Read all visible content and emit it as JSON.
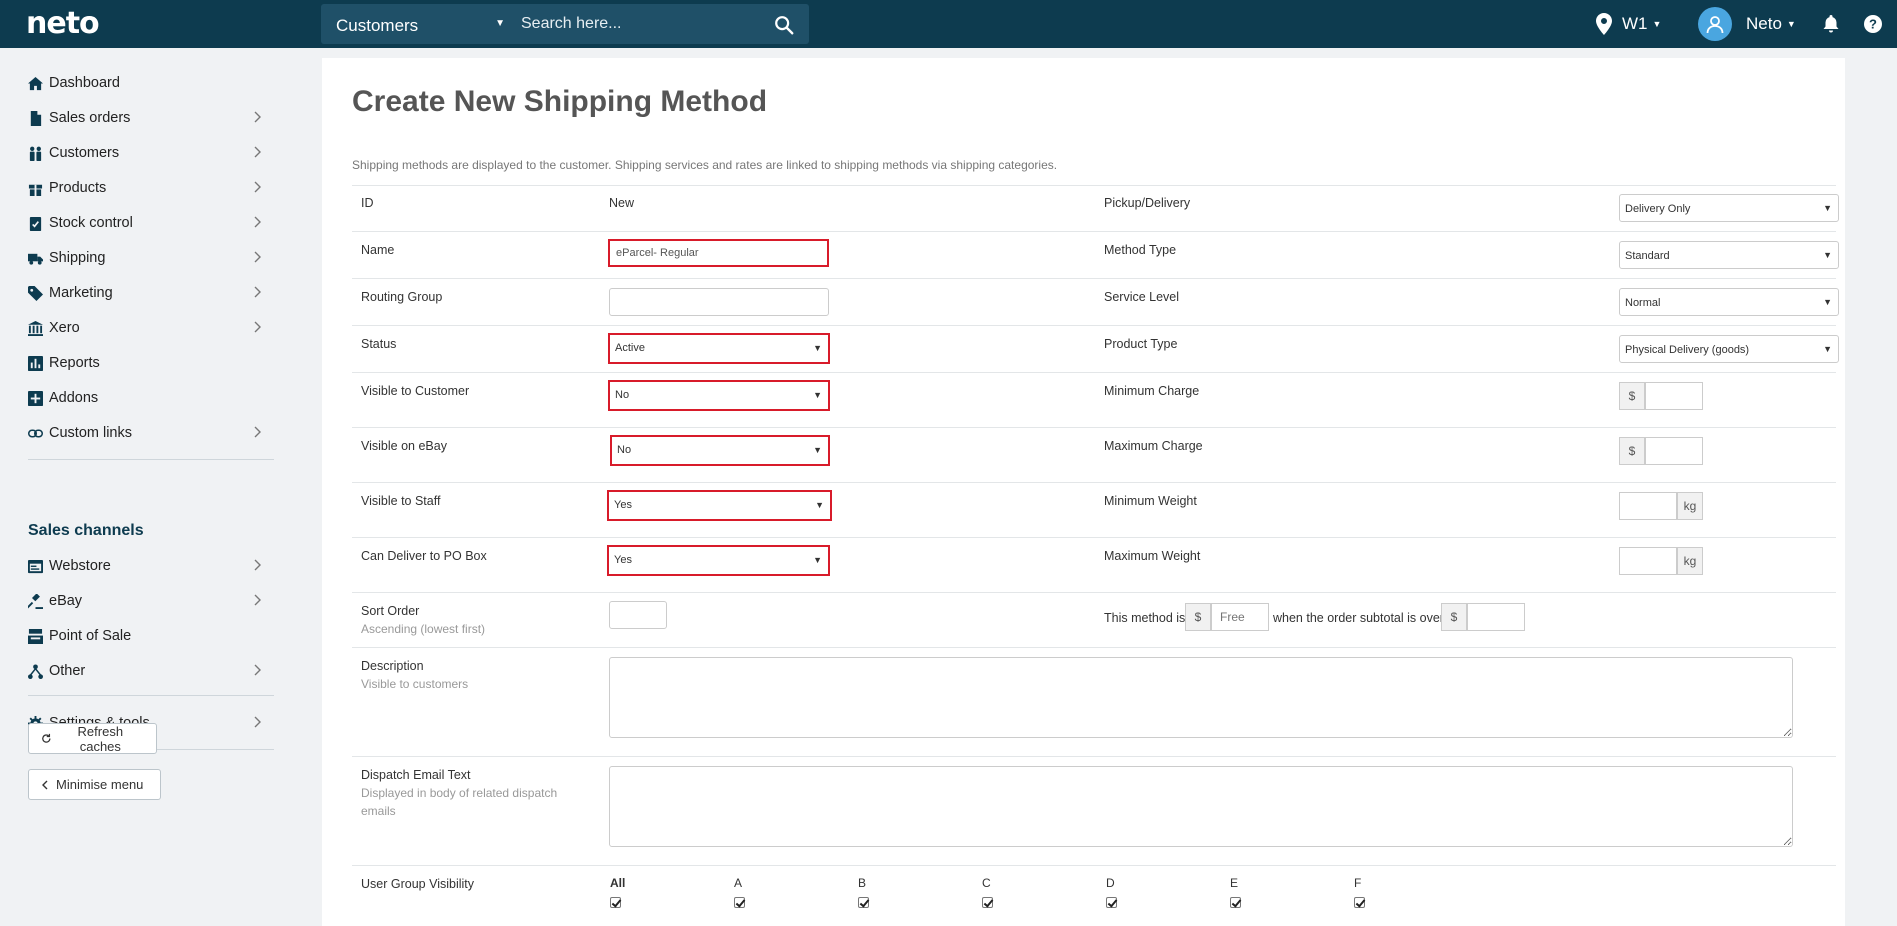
{
  "topbar": {
    "logo": "neto",
    "search_scope": "Customers",
    "search_placeholder": "Search here...",
    "location": "W1",
    "user": "Neto"
  },
  "sidebar": {
    "items": [
      {
        "label": "Dashboard",
        "icon": "home-icon"
      },
      {
        "label": "Sales orders",
        "icon": "document-icon"
      },
      {
        "label": "Customers",
        "icon": "users-icon"
      },
      {
        "label": "Products",
        "icon": "gift-icon"
      },
      {
        "label": "Stock control",
        "icon": "clipboard-check-icon"
      },
      {
        "label": "Shipping",
        "icon": "truck-icon"
      },
      {
        "label": "Marketing",
        "icon": "tag-icon"
      },
      {
        "label": "Xero",
        "icon": "bank-icon"
      },
      {
        "label": "Reports",
        "icon": "bar-chart-icon"
      },
      {
        "label": "Addons",
        "icon": "plus-square-icon"
      },
      {
        "label": "Custom links",
        "icon": "link-icon"
      }
    ],
    "channels_heading": "Sales channels",
    "channels": [
      {
        "label": "Webstore",
        "icon": "browser-icon"
      },
      {
        "label": "eBay",
        "icon": "gavel-icon"
      },
      {
        "label": "Point of Sale",
        "icon": "register-icon"
      },
      {
        "label": "Other",
        "icon": "sitemap-icon"
      }
    ],
    "settings": "Settings & tools",
    "refresh_btn": "Refresh caches",
    "minimise_btn": "Minimise menu"
  },
  "form": {
    "title": "Create New Shipping Method",
    "intro": "Shipping methods are displayed to the customer. Shipping services and rates are linked to shipping methods via shipping categories.",
    "id_label": "ID",
    "id_value": "New",
    "name_label": "Name",
    "name_value": "eParcel- Regular",
    "routing_label": "Routing Group",
    "status_label": "Status",
    "status_value": "Active",
    "visible_customer_label": "Visible to Customer",
    "visible_customer_value": "No",
    "visible_ebay_label": "Visible on eBay",
    "visible_ebay_value": "No",
    "visible_staff_label": "Visible to Staff",
    "visible_staff_value": "Yes",
    "po_box_label": "Can Deliver to PO Box",
    "po_box_value": "Yes",
    "sort_label": "Sort Order",
    "sort_sub": "Ascending (lowest first)",
    "pickup_label": "Pickup/Delivery",
    "pickup_value": "Delivery Only",
    "method_type_label": "Method Type",
    "method_type_value": "Standard",
    "service_level_label": "Service Level",
    "service_level_value": "Normal",
    "product_type_label": "Product Type",
    "product_type_value": "Physical Delivery (goods)",
    "min_charge_label": "Minimum Charge",
    "max_charge_label": "Maximum Charge",
    "min_weight_label": "Minimum Weight",
    "max_weight_label": "Maximum Weight",
    "currency": "$",
    "weight_unit": "kg",
    "free_prefix": "This method is",
    "free_placeholder": "Free",
    "free_middle": "when the order subtotal is over",
    "description_label": "Description",
    "description_sub": "Visible to customers",
    "dispatch_label": "Dispatch Email Text",
    "dispatch_sub": "Displayed in body of related dispatch emails",
    "user_group_label": "User Group Visibility",
    "user_groups": [
      "All",
      "A",
      "B",
      "C",
      "D",
      "E",
      "F"
    ]
  }
}
